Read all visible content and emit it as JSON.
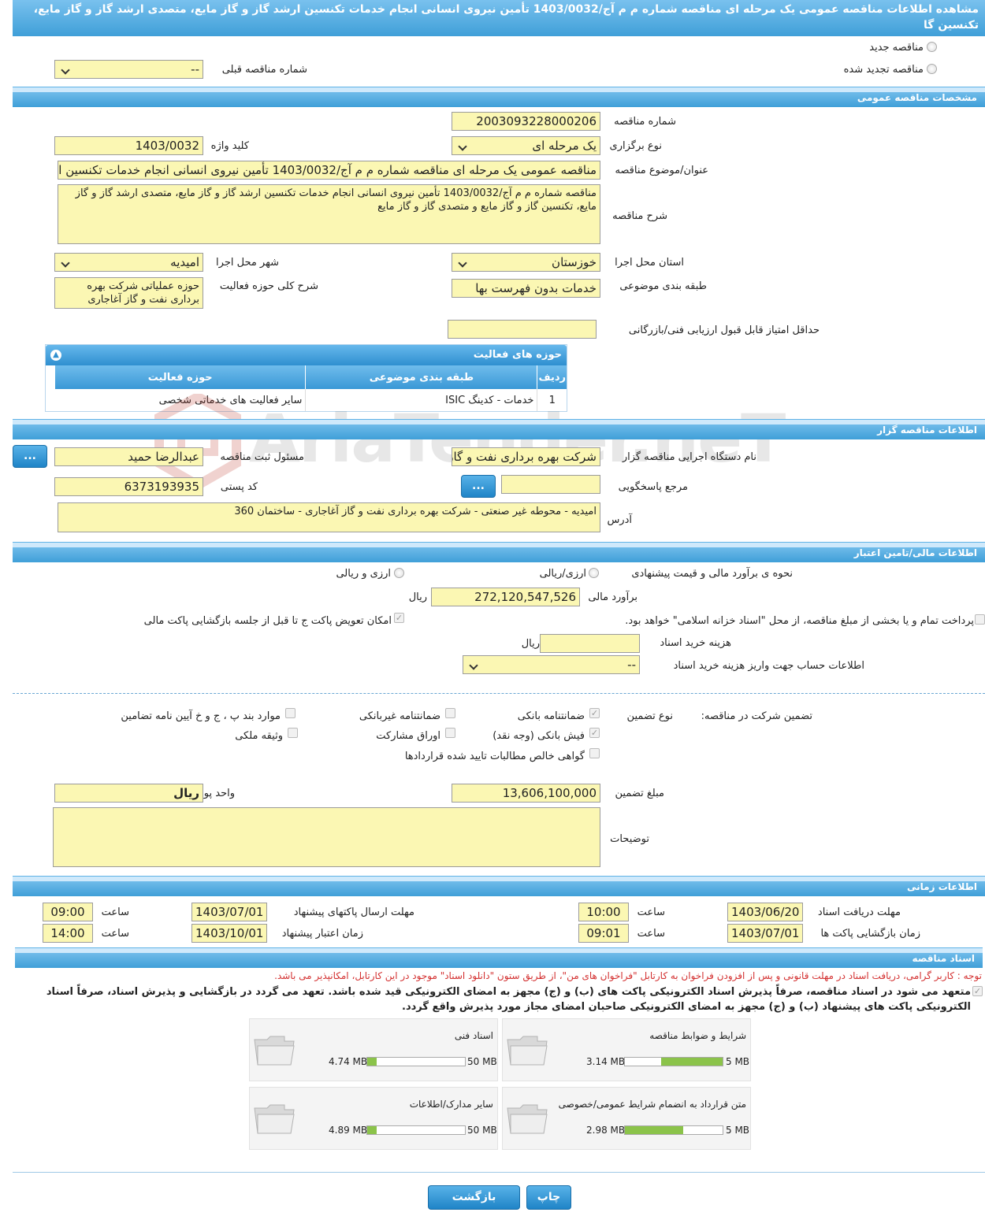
{
  "page": {
    "title": "مشاهده اطلاعات مناقصه عمومی یک مرحله ای مناقصه شماره م م آج/1403/0032 تأمین نیروی انسانی انجام خدمات تکنسین ارشد گاز و گاز مایع، متصدی ارشد گاز و گاز مایع، تکنسین گا"
  },
  "top_options": {
    "new_tender": "مناقصه جدید",
    "renewed_tender": "مناقصه تجدید شده",
    "previous_number_label": "شماره مناقصه قبلی",
    "previous_number_value": "--"
  },
  "general": {
    "section_title": "مشخصات مناقصه عمومی",
    "tender_number_label": "شماره مناقصه",
    "tender_number": "2003093228000206",
    "hold_type_label": "نوع برگزاری",
    "hold_type": "یک مرحله ای",
    "keyword_label": "کلید واژه",
    "keyword": "1403/0032",
    "subject_label": "عنوان/موضوع مناقصه",
    "subject": "مناقصه عمومی یک مرحله ای مناقصه شماره م م آج/1403/0032 تأمین نیروی انسانی انجام خدمات تکنسین ارشد گاز و گاز مایع",
    "description_label": "شرح مناقصه",
    "description": "مناقصه شماره م م آج/1403/0032 تأمین نیروی انسانی انجام خدمات تکنسین ارشد گاز و گاز مایع، متصدی ارشد گاز و گاز مایع، تکنسین گاز و گاز مایع و متصدی گاز و گاز مایع",
    "province_label": "استان محل اجرا",
    "province": "خوزستان",
    "city_label": "شهر محل اجرا",
    "city": "امیدیه",
    "category_label": "طبقه بندی موضوعی",
    "category": "خدمات بدون فهرست بها",
    "activity_desc_label": "شرح کلی حوزه فعالیت",
    "activity_desc": "حوزه عملیاتی شرکت بهره برداری نفت و گاز آغاجاری",
    "min_score_label": "حداقل امتیاز قابل قبول ارزیابی فنی/بازرگانی",
    "min_score": ""
  },
  "activities": {
    "panel_title": "حوزه های فعالیت",
    "headers": [
      "ردیف",
      "طبقه بندی موضوعی",
      "حوزه فعالیت"
    ],
    "rows": [
      {
        "row": "1",
        "category": "خدمات - کدینگ ISIC",
        "field": "سایر فعالیت های خدماتی شخصی"
      }
    ]
  },
  "organizer": {
    "section_title": "اطلاعات مناقصه گزار",
    "org_label": "نام دستگاه اجرایی مناقصه گزار",
    "org": "شرکت بهره برداری نفت و گاز آغاجاری",
    "registrar_label": "مسئول ثبت مناقصه",
    "registrar": "عبدالرضا  حمید",
    "ref_label": "مرجع پاسخگویی",
    "ref": "",
    "postal_label": "کد پستی",
    "postal": "6373193935",
    "address_label": "آدرس",
    "address": "امیدیه - محوطه غیر صنعتی - شرکت بهره برداری نفت و گاز آغاجاری - ساختمان 360",
    "more_button": "..."
  },
  "finance": {
    "section_title": "اطلاعات مالی/تامین اعتبار",
    "method_label": "نحوه ی برآورد مالی و قیمت پیشنهادی",
    "option_rial": "ارزی/ریالی",
    "option_both": "ارزی و ریالی",
    "estimate_label": "برآورد مالی",
    "estimate": "272,120,547,526",
    "estimate_unit": "ریال",
    "treasury_text": "پرداخت تمام و یا بخشی از مبلغ مناقصه، از محل \"اسناد خزانه اسلامی\" خواهد بود.",
    "envelope_text": "امکان تعویض پاکت ج تا قبل از جلسه بازگشایی پاکت مالی",
    "doc_cost_label": "هزینه خرید اسناد",
    "doc_cost": "",
    "doc_cost_unit": "ریال",
    "account_label": "اطلاعات حساب جهت واریز هزینه خرید اسناد",
    "account": "--"
  },
  "guarantee": {
    "title_label": "تضمین شرکت در مناقصه:",
    "type_label": "نوع تضمین",
    "options": {
      "bank_guarantee": "ضمانتنامه بانکی",
      "nonbank_guarantee": "ضمانتنامه غیربانکی",
      "regulation_items": "موارد بند پ ، ج و خ آیین نامه تضامین",
      "bank_receipt": "فیش بانکی (وجه نقد)",
      "participation_bonds": "اوراق مشارکت",
      "property_mortgage": "وثیقه ملکی",
      "net_receivables": "گواهی خالص مطالبات تایید شده قراردادها"
    },
    "amount_label": "مبلغ تضمین",
    "amount": "13,606,100,000",
    "currency_label": "واحد پول",
    "currency": "ریال",
    "notes_label": "توضیحات",
    "notes": ""
  },
  "timing": {
    "section_title": "اطلاعات زمانی",
    "doc_receive_label": "مهلت دریافت اسناد",
    "doc_receive_date": "1403/06/20",
    "doc_receive_time": "10:00",
    "send_label": "مهلت ارسال پاکتهای پیشنهاد",
    "send_date": "1403/07/01",
    "send_time": "09:00",
    "open_label": "زمان بازگشایی پاکت ها",
    "open_date": "1403/07/01",
    "open_time": "09:01",
    "validity_label": "زمان اعتبار پیشنهاد",
    "validity_date": "1403/10/01",
    "validity_time": "14:00",
    "time_label": "ساعت"
  },
  "documents": {
    "section_title": "اسناد مناقصه",
    "notice": "توجه : کاربر گرامی، دریافت اسناد در مهلت قانونی و پس از افزودن فراخوان به کارتابل \"فراخوان های من\"، از طریق ستون \"دانلود اسناد\" موجود در این کارتابل، امکانپذیر می باشد.",
    "commitment": "متعهد می شود در اسناد مناقصه، صرفاً پذیرش اسناد الکترونیکی پاکت های (ب) و (ج) مجهز به امضای الکترونیکی قید شده باشد. تعهد می گردد در بازگشایی و پذیرش اسناد، صرفاً اسناد الکترونیکی پاکت های پیشنهاد (ب) و (ج) مجهز به امضای الکترونیکی صاحبان امضای مجاز مورد پذیرش واقع گردد.",
    "files": [
      {
        "name": "شرایط و ضوابط مناقصه",
        "size": "3.14 MB",
        "max": "5 MB",
        "fraction": 0.628
      },
      {
        "name": "اسناد فنی",
        "size": "4.74 MB",
        "max": "50 MB",
        "fraction": 0.095
      },
      {
        "name": "متن قرارداد به انضمام شرایط عمومی/خصوصی",
        "size": "2.98 MB",
        "max": "5 MB",
        "fraction": 0.596
      },
      {
        "name": "سایر مدارک/اطلاعات",
        "size": "4.89 MB",
        "max": "50 MB",
        "fraction": 0.098
      }
    ]
  },
  "actions": {
    "back": "بازگشت",
    "print": "چاپ"
  },
  "watermark": "AriaTender.neT",
  "colors": {
    "header_blue": "#3f9fd8",
    "field_yellow": "#fbf7b3",
    "progress_green": "#8bc34a",
    "notice_red": "#d32f2f"
  }
}
